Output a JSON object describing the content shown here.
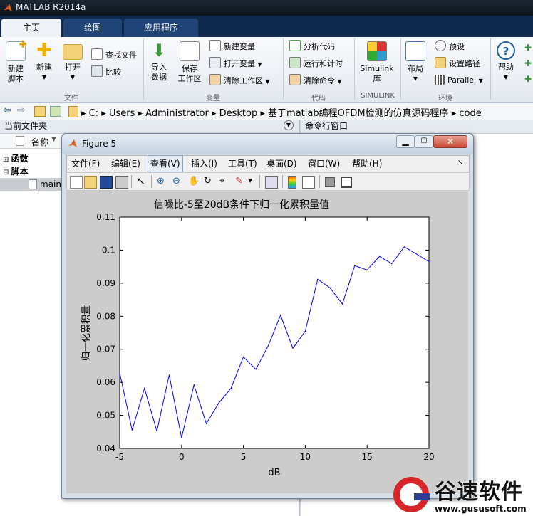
{
  "app": {
    "title": "MATLAB R2014a"
  },
  "tabs": [
    {
      "label": "主页"
    },
    {
      "label": "绘图"
    },
    {
      "label": "应用程序"
    }
  ],
  "ribbon": {
    "file": {
      "new_script": "新建\n脚本",
      "new": "新建",
      "open": "打开",
      "find_files": "查找文件",
      "compare": "比较",
      "group": "文件"
    },
    "variable": {
      "import": "导入\n数据",
      "save_ws": "保存\n工作区",
      "new_var": "新建变量",
      "open_var": "打开变量",
      "clear_ws": "清除工作区",
      "group": "变量"
    },
    "code": {
      "analyze": "分析代码",
      "run_time": "运行和计时",
      "clear_cmd": "清除命令",
      "group": "代码"
    },
    "simulink": {
      "btn": "Simulink\n库",
      "group": "SIMULINK"
    },
    "env": {
      "layout": "布局",
      "prefs": "预设",
      "set_path": "设置路径",
      "parallel": "Parallel",
      "group": "环境"
    },
    "help": {
      "label": "帮助"
    }
  },
  "address": {
    "segments": [
      "C:",
      "Users",
      "Administrator",
      "Desktop",
      "基于matlab编程OFDM检测的仿真源码程序",
      "code"
    ]
  },
  "left_panel": {
    "title": "当前文件夹",
    "col_name": "名称",
    "items": [
      {
        "label": "函数"
      },
      {
        "label": "脚本"
      },
      {
        "label": "main.m"
      }
    ]
  },
  "right_panel": {
    "title": "命令行窗口"
  },
  "figure": {
    "title": "Figure 5",
    "menu": [
      "文件(F)",
      "编辑(E)",
      "查看(V)",
      "插入(I)",
      "工具(T)",
      "桌面(D)",
      "窗口(W)",
      "帮助(H)"
    ]
  },
  "chart_data": {
    "type": "line",
    "title": "信噪比-5至20dB条件下归一化累积量值",
    "xlabel": "dB",
    "ylabel": "归一化累积量",
    "xlim": [
      -5,
      20
    ],
    "ylim": [
      0.04,
      0.11
    ],
    "xticks": [
      "-5",
      "0",
      "5",
      "10",
      "15",
      "20"
    ],
    "yticks": [
      "0.04",
      "0.05",
      "0.06",
      "0.07",
      "0.08",
      "0.09",
      "0.1",
      "0.11"
    ],
    "grid": false,
    "line_color": "#0000ff",
    "series": [
      {
        "x": [
          -5,
          -4,
          -3,
          -2,
          -1,
          0,
          1,
          2,
          3,
          4,
          5,
          6,
          7,
          8,
          9,
          10,
          11,
          12,
          13,
          14,
          15,
          16,
          17,
          18,
          19,
          20
        ],
        "values": [
          0.0628,
          0.0455,
          0.0582,
          0.0452,
          0.0622,
          0.0432,
          0.0592,
          0.0475,
          0.0537,
          0.0582,
          0.0677,
          0.0639,
          0.071,
          0.0803,
          0.0703,
          0.0755,
          0.0912,
          0.0886,
          0.0837,
          0.0953,
          0.094,
          0.0981,
          0.0959,
          0.101,
          0.0988,
          0.0965
        ]
      }
    ]
  },
  "watermark": {
    "brand": "谷速软件",
    "url": "www.gususoft.com"
  }
}
